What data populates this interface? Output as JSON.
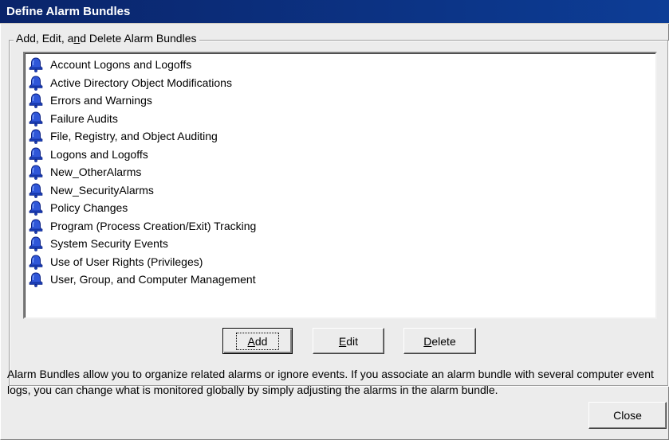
{
  "window": {
    "title": "Define Alarm Bundles"
  },
  "group": {
    "label_pre": "Add, Edit, a",
    "label_mnemonic": "n",
    "label_post": "d Delete Alarm Bundles"
  },
  "bundles": [
    {
      "label": "Account Logons and Logoffs",
      "icon": "bell-icon"
    },
    {
      "label": "Active Directory Object Modifications",
      "icon": "bell-icon"
    },
    {
      "label": "Errors and Warnings",
      "icon": "bell-icon"
    },
    {
      "label": "Failure Audits",
      "icon": "bell-icon"
    },
    {
      "label": "File, Registry, and Object Auditing",
      "icon": "bell-icon"
    },
    {
      "label": "Logons and Logoffs",
      "icon": "bell-icon"
    },
    {
      "label": "New_OtherAlarms",
      "icon": "bell-icon"
    },
    {
      "label": "New_SecurityAlarms",
      "icon": "bell-icon"
    },
    {
      "label": "Policy Changes",
      "icon": "bell-icon"
    },
    {
      "label": "Program (Process Creation/Exit) Tracking",
      "icon": "bell-icon"
    },
    {
      "label": "System Security Events",
      "icon": "bell-icon"
    },
    {
      "label": "Use of User Rights (Privileges)",
      "icon": "bell-icon"
    },
    {
      "label": "User, Group, and Computer Management",
      "icon": "bell-icon"
    }
  ],
  "buttons": {
    "add": {
      "mnemonic": "A",
      "rest": "dd"
    },
    "edit": {
      "mnemonic": "E",
      "rest": "dit"
    },
    "delete": {
      "mnemonic": "D",
      "rest": "elete"
    },
    "close": "Close"
  },
  "description": "Alarm Bundles allow you to organize related alarms or ignore events.  If you associate an alarm bundle with several computer event logs, you can change what is monitored globally by simply adjusting the alarms in the alarm bundle.",
  "colors": {
    "titlebar": "#0a246a",
    "bell_fill": "#2f56d8"
  }
}
